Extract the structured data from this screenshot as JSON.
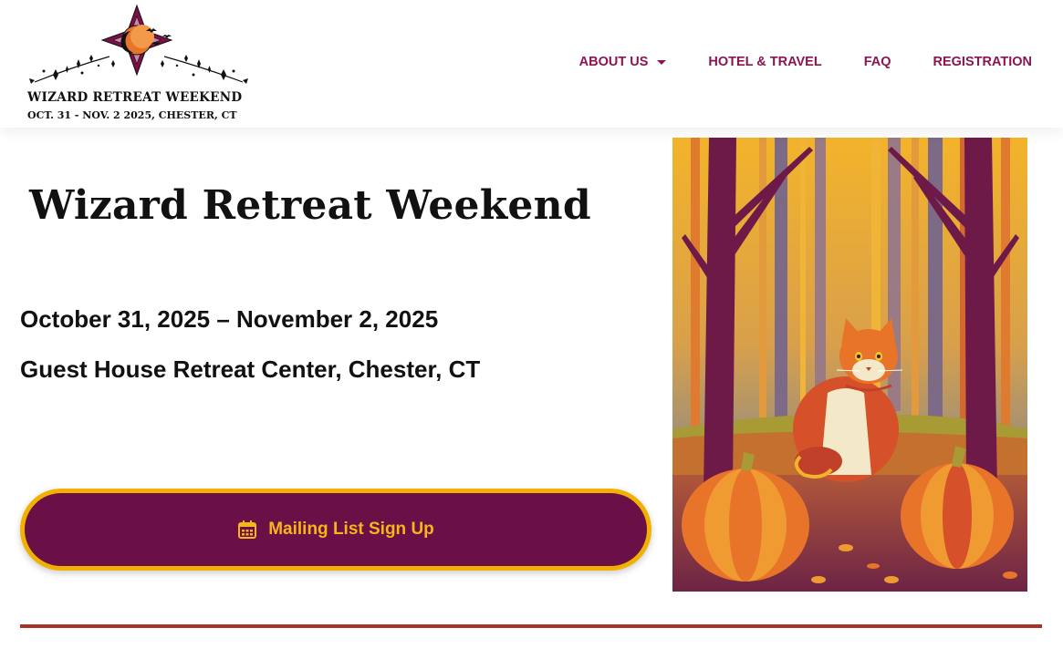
{
  "header": {
    "logo": {
      "line1": "WIZARD RETREAT WEEKEND",
      "line2": "OCT. 31 - NOV. 2 2025, CHESTER, CT"
    },
    "nav": [
      {
        "label": "ABOUT US",
        "has_dropdown": true
      },
      {
        "label": "HOTEL & TRAVEL",
        "has_dropdown": false
      },
      {
        "label": "FAQ",
        "has_dropdown": false
      },
      {
        "label": "REGISTRATION",
        "has_dropdown": false
      }
    ]
  },
  "main": {
    "title": "Wizard Retreat Weekend",
    "dates": "October 31, 2025 – November 2, 2025",
    "location": "Guest House Retreat Center, Chester, CT",
    "signup_button": {
      "label": "Mailing List Sign Up",
      "icon": "calendar-icon"
    }
  },
  "colors": {
    "brand": "#8a1552",
    "button_bg": "#6b0f47",
    "button_accent": "#f2b100",
    "divider": "#a8322a"
  }
}
